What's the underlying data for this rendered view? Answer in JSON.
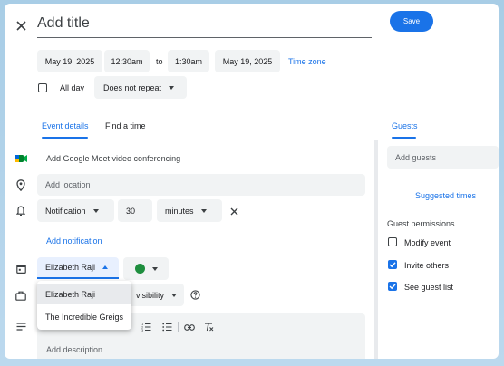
{
  "header": {
    "title_placeholder": "Add title",
    "save_label": "Save"
  },
  "datetime": {
    "start_date": "May 19, 2025",
    "start_time": "12:30am",
    "to_label": "to",
    "end_time": "1:30am",
    "end_date": "May 19, 2025",
    "time_zone_label": "Time zone",
    "all_day_label": "All day",
    "repeat_value": "Does not repeat"
  },
  "tabs": {
    "event_details": "Event details",
    "find_a_time": "Find a time"
  },
  "details": {
    "meet_label": "Add Google Meet video conferencing",
    "location_placeholder": "Add location",
    "notification_type": "Notification",
    "notification_value": "30",
    "notification_unit": "minutes",
    "add_notification_label": "Add notification",
    "calendar_selected": "Elizabeth Raji",
    "calendar_options": [
      "Elizabeth Raji",
      "The Incredible Greigs"
    ],
    "visibility_label": "visibility",
    "description_placeholder": "Add description"
  },
  "guests": {
    "tab_label": "Guests",
    "add_guests_placeholder": "Add guests",
    "suggested_times_label": "Suggested times",
    "permissions_heading": "Guest permissions",
    "permissions": [
      {
        "label": "Modify event",
        "checked": false
      },
      {
        "label": "Invite others",
        "checked": true
      },
      {
        "label": "See guest list",
        "checked": true
      }
    ]
  },
  "colors": {
    "accent": "#1a73e8",
    "event_color": "#1e8e3e",
    "surface": "#f1f3f4"
  }
}
